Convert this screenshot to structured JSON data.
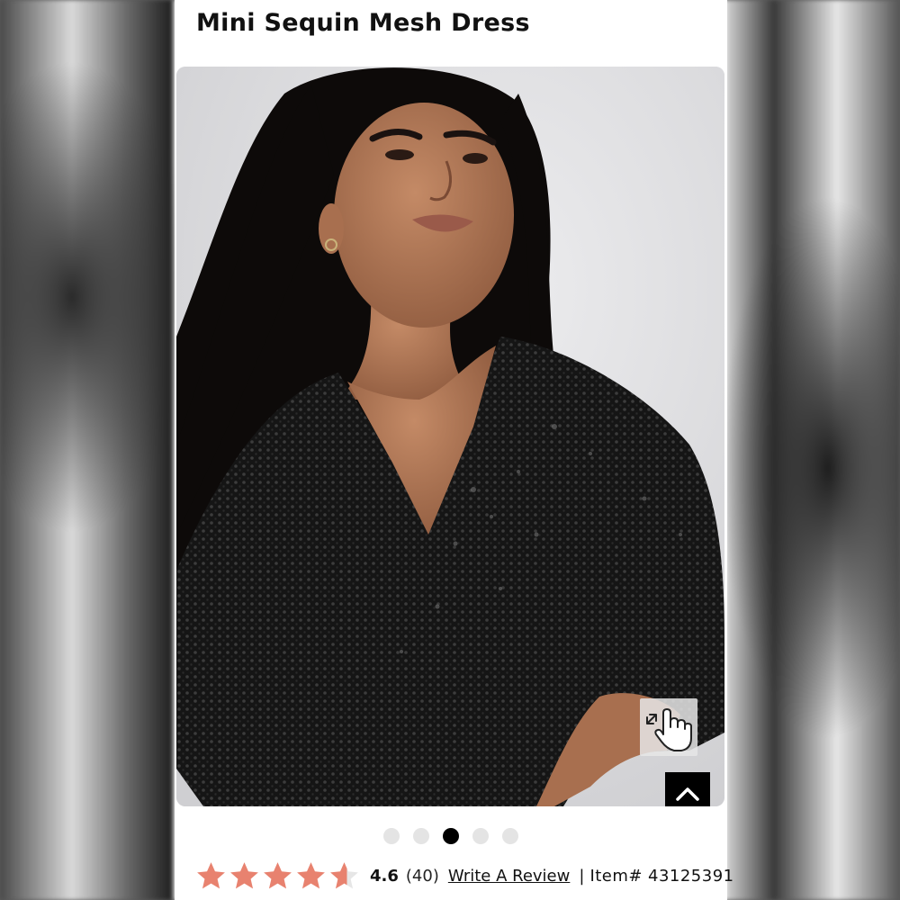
{
  "product": {
    "title": "Mini Sequin Mesh Dress"
  },
  "gallery": {
    "slide_count": 5,
    "active_index": 2,
    "zoom_icon": "tap-to-zoom-hand-icon",
    "back_to_top_icon": "chevron-up-icon"
  },
  "rating": {
    "value": "4.6",
    "count": "(40)",
    "stars_filled": 4.6,
    "write_review_label": "Write A Review",
    "separator": "|",
    "item_label": "Item#",
    "item_number": "43125391"
  },
  "colors": {
    "star": "#e8826f",
    "star_empty": "#e6e6e6",
    "dot_active": "#000000",
    "dot_inactive": "#e4e4e4"
  }
}
